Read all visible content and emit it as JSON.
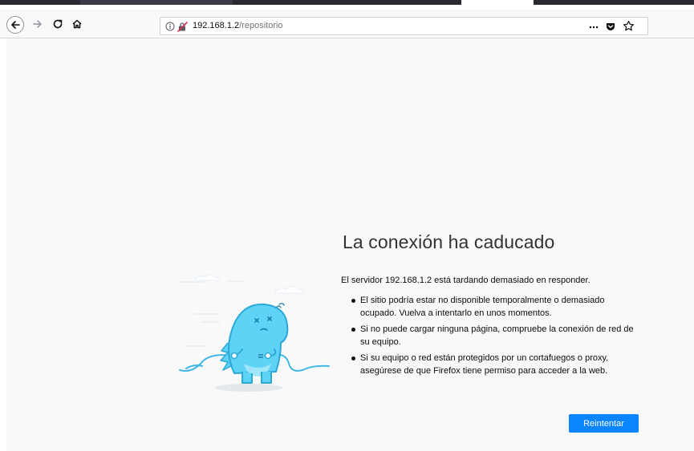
{
  "browser": {
    "url_host": "192.168.1.2",
    "url_path": "/repositorio",
    "icons": [
      "back-arrow-icon",
      "forward-arrow-icon",
      "reload-icon",
      "home-icon",
      "info-icon",
      "insecure-lock-icon",
      "page-actions-icon",
      "pocket-icon",
      "bookmark-star-icon"
    ]
  },
  "error_page": {
    "title": "La conexión ha caducado",
    "description": "El servidor 192.168.1.2 está tardando demasiado en responder.",
    "bullets": [
      "El sitio podría estar no disponible temporalmente o demasiado ocupado. Vuelva a intentarlo en unos momentos.",
      "Si no puede cargar ninguna página, compruebe la conexión de red de su equipo.",
      "Si su equipo o red están protegidos por un cortafuegos o proxy, asegúrese de que Firefox tiene permiso para acceder a la web."
    ],
    "retry_label": "Reintentar"
  },
  "colors": {
    "accent": "#0a84ff",
    "page_bg": "#f9f9fa",
    "illustration": "#5fd3f5"
  }
}
